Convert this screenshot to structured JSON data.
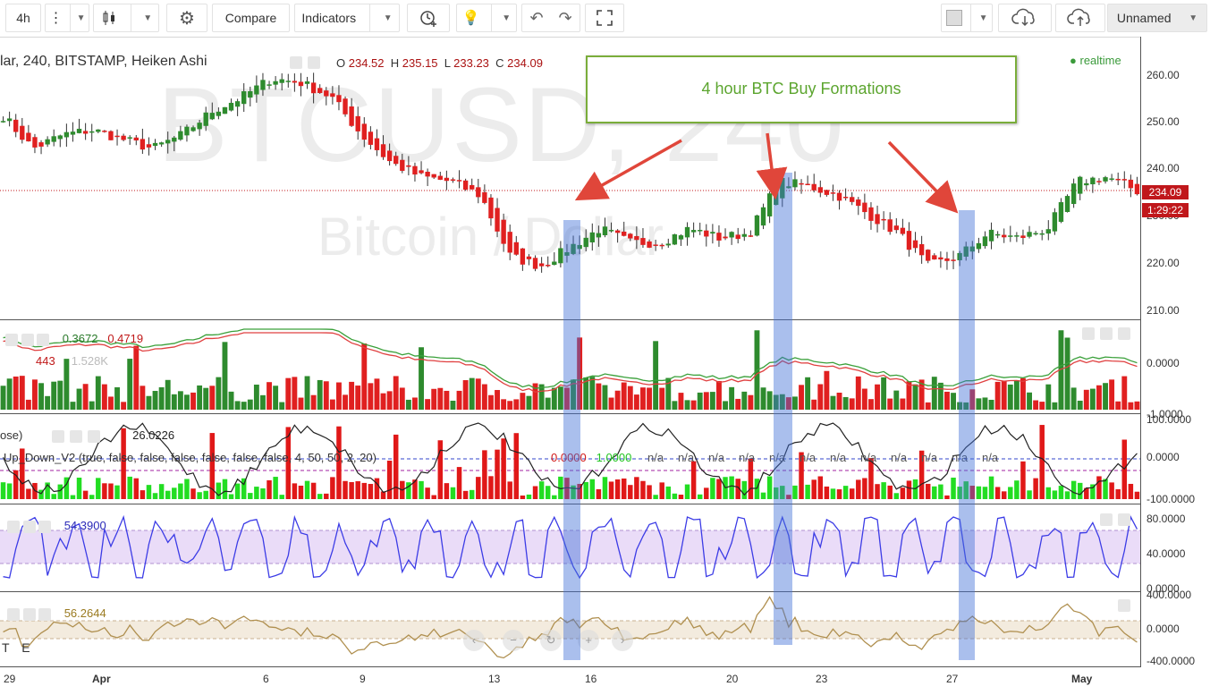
{
  "toolbar": {
    "interval": "4h",
    "compare": "Compare",
    "indicators": "Indicators",
    "layout_name": "Unnamed",
    "icons": [
      "more-vert-icon",
      "candles-icon",
      "gear-icon",
      "alert-clock-icon",
      "bulb-icon",
      "undo-icon",
      "redo-icon",
      "fullscreen-icon",
      "color-swatch-icon",
      "cloud-download-icon",
      "cloud-upload-icon"
    ]
  },
  "main_legend": {
    "symbol": "lar, 240, BITSTAMP, Heiken Ashi",
    "o_label": "O",
    "o": "234.52",
    "h_label": "H",
    "h": "235.15",
    "l_label": "L",
    "l": "233.23",
    "c_label": "C",
    "c": "234.09",
    "realtime": "realtime"
  },
  "watermark": {
    "symbol": "BTCUSD, 240",
    "name": "Bitcoin / Dollar"
  },
  "annotation": {
    "text": "4 hour BTC Buy Formations",
    "color": "#5ca52f"
  },
  "price_tag": {
    "price": "234.09",
    "countdown": "1:29:22"
  },
  "colors": {
    "up": "#2e8b2e",
    "down": "#e02020",
    "highlight": "#4272d6",
    "osc": "#3c3ce6",
    "cci": "#b09050"
  },
  "pane2": {
    "v1": "0.3672",
    "v2": "0.4719",
    "v3": "443",
    "v4": "1.528K"
  },
  "pane3": {
    "prefix": "ose)",
    "value": "26.0226",
    "study": "Up_Down_V2 (true, false, false, false, false, false, false, 4, 50, 50, 2, 20)",
    "s1": "0.0000",
    "s2": "1.0000",
    "na": "n/a"
  },
  "pane4": {
    "value": "54.3900"
  },
  "pane5": {
    "value": "56.2644",
    "corner": "T E"
  },
  "price_axis": {
    "main": [
      "260.00",
      "250.00",
      "240.00",
      "230.00",
      "220.00",
      "210.00"
    ],
    "vol": [
      "0.0000",
      "-1.0000"
    ],
    "updown": [
      "100.0000",
      "0.0000",
      "-100.0000"
    ],
    "osc": [
      "80.0000",
      "40.0000",
      "0.0000"
    ],
    "cci": [
      "400.0000",
      "0.0000",
      "-400.0000"
    ]
  },
  "time_axis": [
    "29",
    "Apr",
    "6",
    "9",
    "13",
    "16",
    "20",
    "23",
    "27",
    "May"
  ],
  "chart_data": {
    "type": "candlestick",
    "title": "lar, 240, BITSTAMP, Heiken Ashi",
    "ylim": [
      205,
      264
    ],
    "highlight_dates": [
      "Apr 15",
      "Apr 22",
      "Apr 27"
    ],
    "close_path": [
      {
        "x": "Mar 29",
        "y": 250
      },
      {
        "x": "Mar 30",
        "y": 243
      },
      {
        "x": "Mar 31",
        "y": 246
      },
      {
        "x": "Apr 1",
        "y": 247
      },
      {
        "x": "Apr 2",
        "y": 245
      },
      {
        "x": "Apr 3",
        "y": 243
      },
      {
        "x": "Apr 4",
        "y": 246
      },
      {
        "x": "Apr 5",
        "y": 251
      },
      {
        "x": "Apr 6",
        "y": 254
      },
      {
        "x": "Apr 6",
        "y": 258
      },
      {
        "x": "Apr 7",
        "y": 257
      },
      {
        "x": "Apr 8",
        "y": 254
      },
      {
        "x": "Apr 9",
        "y": 246
      },
      {
        "x": "Apr 10",
        "y": 240
      },
      {
        "x": "Apr 11",
        "y": 237
      },
      {
        "x": "Apr 12",
        "y": 236
      },
      {
        "x": "Apr 13",
        "y": 233
      },
      {
        "x": "Apr 14",
        "y": 220
      },
      {
        "x": "Apr 14",
        "y": 218
      },
      {
        "x": "Apr 15",
        "y": 222
      },
      {
        "x": "Apr 16",
        "y": 226
      },
      {
        "x": "Apr 17",
        "y": 223
      },
      {
        "x": "Apr 18",
        "y": 223
      },
      {
        "x": "Apr 19",
        "y": 226
      },
      {
        "x": "Apr 20",
        "y": 224
      },
      {
        "x": "Apr 21",
        "y": 225
      },
      {
        "x": "Apr 22",
        "y": 236
      },
      {
        "x": "Apr 23",
        "y": 235
      },
      {
        "x": "Apr 24",
        "y": 233
      },
      {
        "x": "Apr 25",
        "y": 229
      },
      {
        "x": "Apr 26",
        "y": 225
      },
      {
        "x": "Apr 27",
        "y": 218
      },
      {
        "x": "Apr 27",
        "y": 220
      },
      {
        "x": "Apr 28",
        "y": 225
      },
      {
        "x": "Apr 29",
        "y": 224
      },
      {
        "x": "Apr 30",
        "y": 226
      },
      {
        "x": "May 1",
        "y": 236
      },
      {
        "x": "May 1",
        "y": 237
      },
      {
        "x": "May 2",
        "y": 234
      }
    ],
    "last_close": 234.09
  }
}
